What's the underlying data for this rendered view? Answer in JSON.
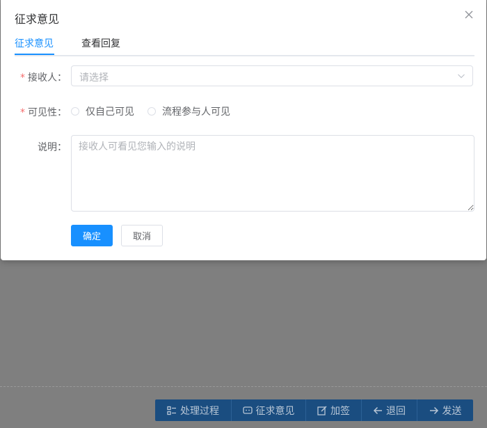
{
  "dialog": {
    "title": "征求意见",
    "close_icon": "close-icon"
  },
  "tabs": [
    {
      "label": "征求意见",
      "active": true
    },
    {
      "label": "查看回复",
      "active": false
    }
  ],
  "form": {
    "receiver": {
      "label": "接收人：",
      "required_mark": "*",
      "placeholder": "请选择"
    },
    "visibility": {
      "label": "可见性：",
      "required_mark": "*",
      "options": [
        {
          "label": "仅自己可见",
          "selected": false
        },
        {
          "label": "流程参与人可见",
          "selected": false
        }
      ]
    },
    "description": {
      "label": "说明：",
      "placeholder": "接收人可看见您输入的说明"
    }
  },
  "buttons": {
    "confirm": "确定",
    "cancel": "取消"
  },
  "action_bar": {
    "items": [
      {
        "label": "处理过程",
        "icon": "list-icon"
      },
      {
        "label": "征求意见",
        "icon": "chat-icon"
      },
      {
        "label": "加签",
        "icon": "edit-icon"
      },
      {
        "label": "退回",
        "icon": "arrow-left-icon"
      },
      {
        "label": "发送",
        "icon": "arrow-right-icon"
      }
    ]
  },
  "colors": {
    "primary": "#1890ff",
    "required": "#f56c6c",
    "overlay": "#7f7f7f",
    "action_bar": "#1a4d80"
  }
}
